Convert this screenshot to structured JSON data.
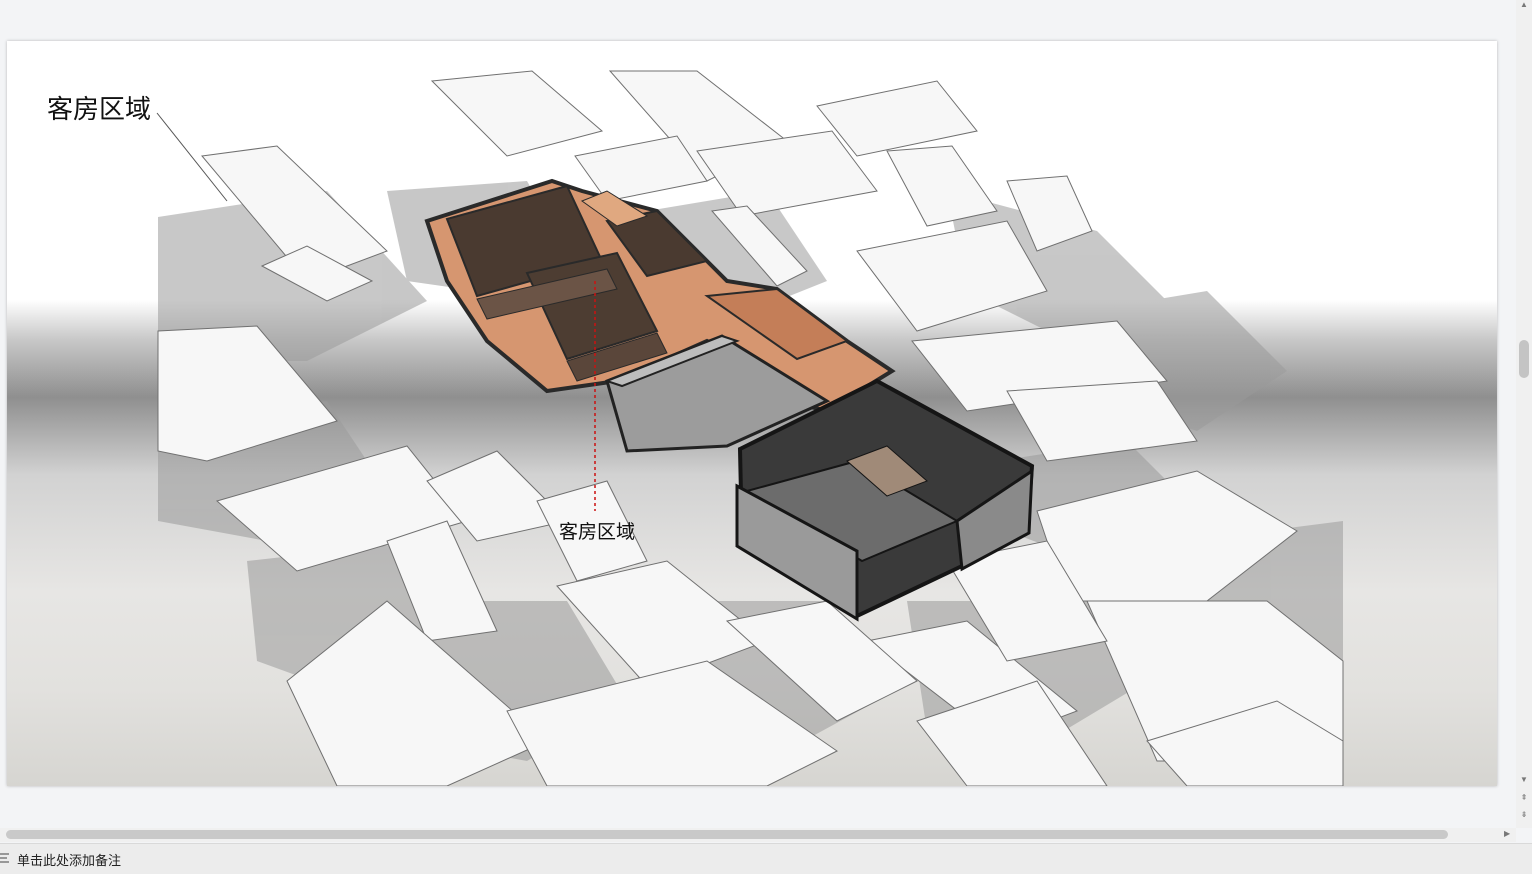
{
  "slide": {
    "title": "客房区域",
    "label": "客房区域"
  },
  "notes": {
    "placeholder": "单击此处添加备注"
  },
  "colors": {
    "accent_guide_line": "#cc1111",
    "wood": "#d69670",
    "dark_roof": "#3a3a3a"
  }
}
